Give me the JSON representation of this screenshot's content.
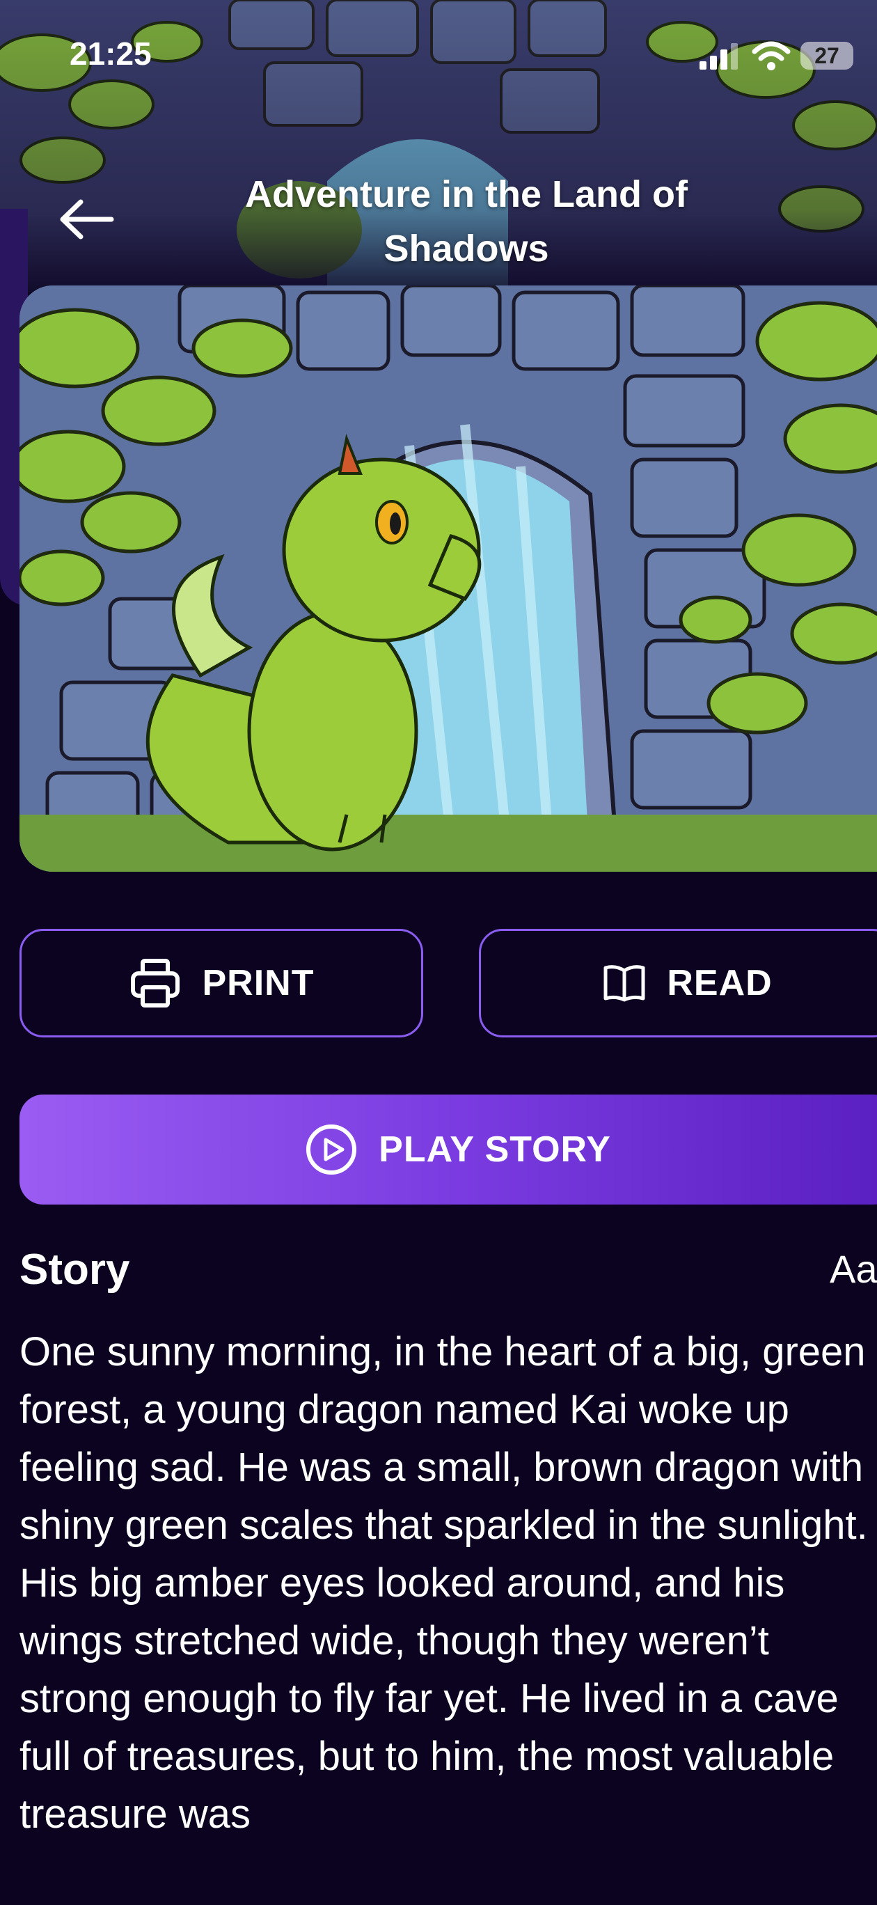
{
  "status_bar": {
    "time": "21:25",
    "battery": "27"
  },
  "header": {
    "title": "Adventure in the Land of Shadows"
  },
  "actions": {
    "print_label": "PRINT",
    "read_label": "READ",
    "play_label": "PLAY STORY"
  },
  "story": {
    "heading": "Story",
    "font_toggle": "Aa",
    "text": "One sunny morning, in the heart of a big, green forest, a young dragon named Kai woke up feeling sad. He was a small, brown dragon with shiny green scales that sparkled in the sunlight. His big amber eyes looked around, and his wings stretched wide, though they weren’t strong enough to fly far yet. He lived in a cave full of treasures, but to him, the most valuable treasure was"
  },
  "icons": {
    "back": "arrow-left-icon",
    "print": "printer-icon",
    "read": "book-icon",
    "play": "play-circle-icon",
    "signal": "signal-icon",
    "wifi": "wifi-icon"
  },
  "colors": {
    "background": "#0b0320",
    "accent": "#8a5cf0",
    "play_gradient_start": "#9a5cf2",
    "play_gradient_end": "#5a1fc0"
  }
}
